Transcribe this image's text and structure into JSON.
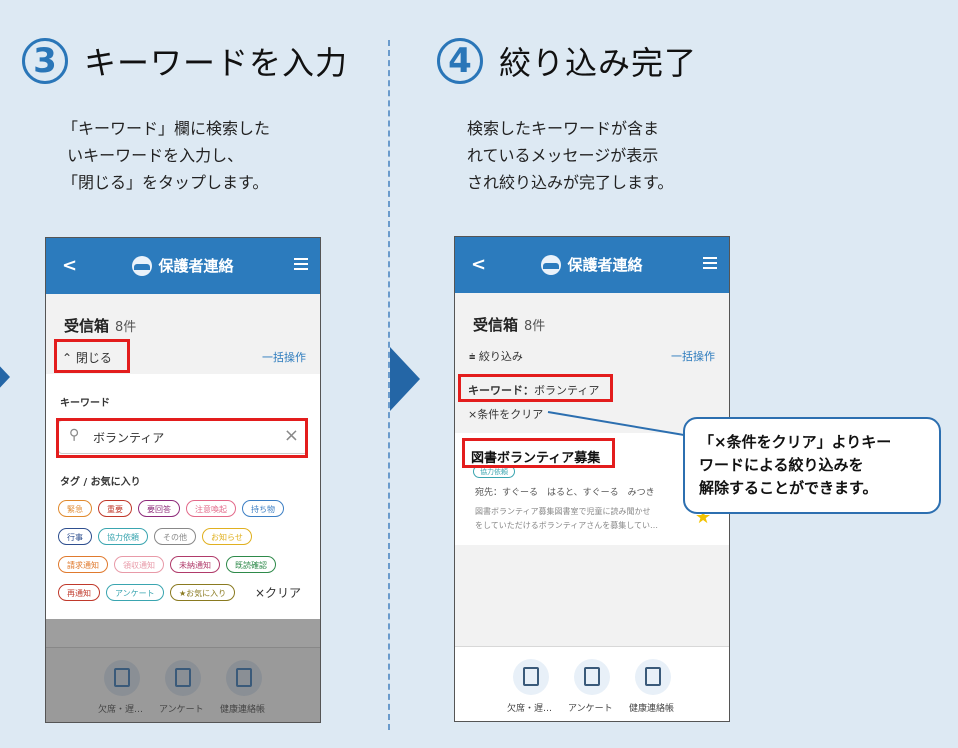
{
  "colors": {
    "accent": "#2c7bbd",
    "highlight": "#e31d1d",
    "background": "#dde9f3"
  },
  "steps": [
    {
      "number": "3",
      "title": "キーワードを入力",
      "description": "「キーワード」欄に検索した\n いキーワードを入力し、\n「閉じる」をタップします。"
    },
    {
      "number": "4",
      "title": "絞り込み完了",
      "description": "検索したキーワードが含ま\nれているメッセージが表示\nされ絞り込みが完了します。"
    }
  ],
  "app": {
    "title": "保護者連絡",
    "back_icon": "chevron-left-icon",
    "menu_icon": "hamburger-menu-icon",
    "inbox_label": "受信箱",
    "inbox_count": "8件",
    "bulk_action": "一括操作"
  },
  "phone1": {
    "close_label": "閉じる",
    "keyword_heading": "キーワード",
    "search_value": "ボランティア",
    "tags_heading": "タグ / お気に入り",
    "tags": [
      {
        "label": "緊急",
        "color": "#e08a2e"
      },
      {
        "label": "重要",
        "color": "#c0392b"
      },
      {
        "label": "要回答",
        "color": "#8e2a7a"
      },
      {
        "label": "注意喚起",
        "color": "#e36a8a"
      },
      {
        "label": "持ち物",
        "color": "#3d7fc4"
      },
      {
        "label": "行事",
        "color": "#2e4f8f"
      },
      {
        "label": "協力依頼",
        "color": "#3aa5b0"
      },
      {
        "label": "その他",
        "color": "#888888"
      },
      {
        "label": "お知らせ",
        "color": "#e0b020"
      },
      {
        "label": "請求通知",
        "color": "#e07a2e"
      },
      {
        "label": "領収通知",
        "color": "#e89aa8"
      },
      {
        "label": "未納通知",
        "color": "#b03a6a"
      },
      {
        "label": "既読確認",
        "color": "#2e8a4a"
      },
      {
        "label": "再通知",
        "color": "#c0392b"
      },
      {
        "label": "アンケート",
        "color": "#3aa5b0"
      },
      {
        "label": "★お気に入り",
        "color": "#8a7a20"
      }
    ],
    "clear_label": "×クリア"
  },
  "phone2": {
    "filter_label": "絞り込み",
    "keyword_label": "キーワード：",
    "keyword_value": "ボランティア",
    "clear_condition": "×条件をクリア",
    "message": {
      "title": "図書ボランティア募集",
      "tag": "協力依頼",
      "recipients": "宛先：すぐーる　はると、すぐーる　みつき",
      "preview_line1": "図書ボランティア募集図書室で児童に読み聞かせ",
      "preview_line2": "をしていただけるボランティアさんを募集してい…"
    }
  },
  "tabbar": [
    {
      "label": "欠席・遅…",
      "icon": "calendar-attendance-icon"
    },
    {
      "label": "アンケート",
      "icon": "survey-clipboard-icon"
    },
    {
      "label": "健康連絡帳",
      "icon": "health-heart-icon"
    }
  ],
  "callout": {
    "text": "「×条件をクリア」よりキー\nワードによる絞り込みを\n解除することができます。"
  }
}
